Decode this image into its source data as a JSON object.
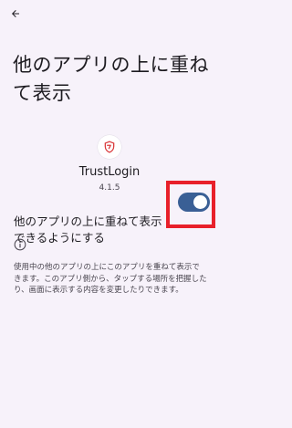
{
  "header": {
    "back_icon": "arrow-back-icon",
    "title": "他のアプリの上に重ねて表示"
  },
  "app": {
    "icon": "trustlogin-shield-icon",
    "name": "TrustLogin",
    "version": "4.1.5"
  },
  "permission": {
    "label": "他のアプリの上に重ねて表示できるようにする",
    "enabled": true,
    "switch_color": "#3a5f95",
    "highlight_color": "#e8202a"
  },
  "info": {
    "icon": "info-icon",
    "description": "使用中の他のアプリの上にこのアプリを重ねて表示できます。このアプリ側から、タップする場所を把握したり、画面に表示する内容を変更したりできます。"
  }
}
